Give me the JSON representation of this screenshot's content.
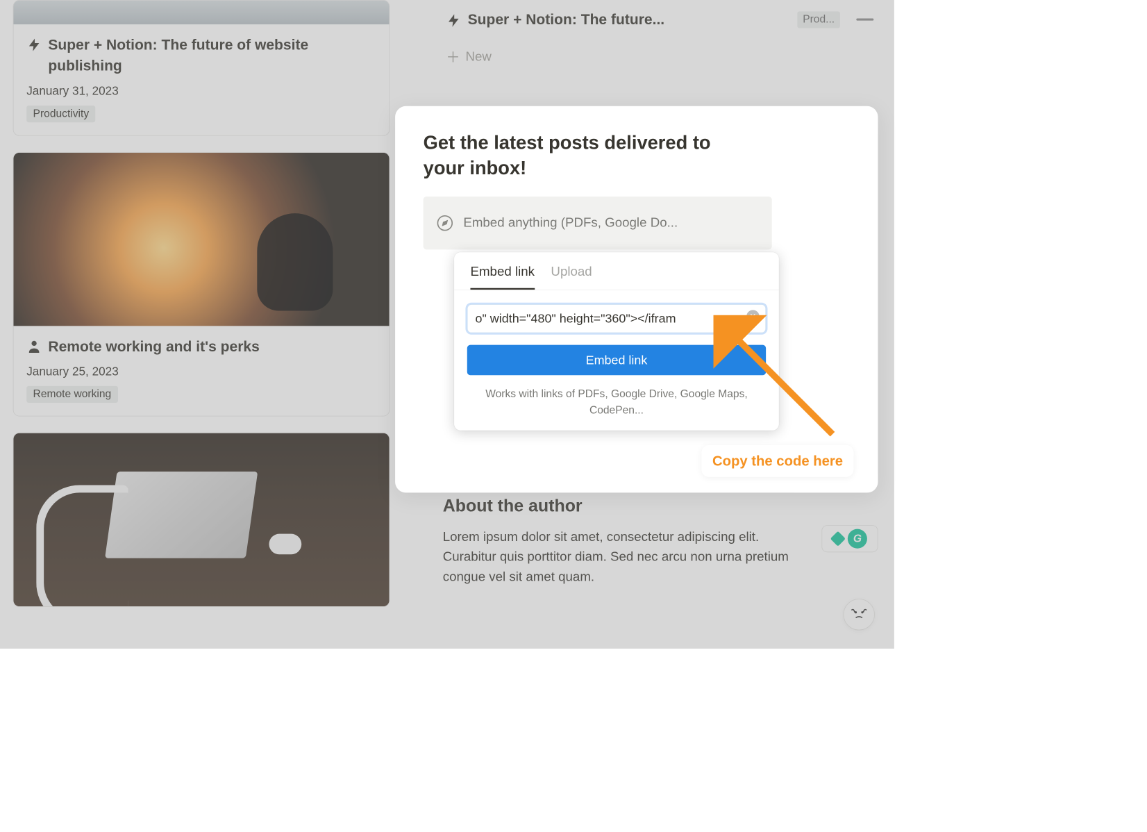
{
  "leftCards": [
    {
      "title": "Super + Notion: The future of website publishing",
      "date": "January 31, 2023",
      "tag": "Productivity",
      "icon": "bolt"
    },
    {
      "title": "Remote working and it's perks",
      "date": "January 25, 2023",
      "tag": "Remote working",
      "icon": "person"
    }
  ],
  "rightHeader": {
    "title": "Super + Notion: The future...",
    "tag": "Prod..."
  },
  "newLabel": "New",
  "modal": {
    "title": "Get the latest posts delivered to your inbox!",
    "embedPlaceholder": "Embed anything (PDFs, Google Do..."
  },
  "popup": {
    "tabs": {
      "embed": "Embed link",
      "upload": "Upload"
    },
    "inputValue": "o\" width=\"480\" height=\"360\"></ifram",
    "buttonLabel": "Embed link",
    "helpText": "Works with links of PDFs, Google Drive, Google Maps, CodePen..."
  },
  "callout": "Copy the code here",
  "about": {
    "title": "About the author",
    "text": "Lorem ipsum dolor sit amet, consectetur adipiscing elit. Curabitur quis porttitor diam. Sed nec arcu non urna pretium congue vel sit amet quam."
  }
}
